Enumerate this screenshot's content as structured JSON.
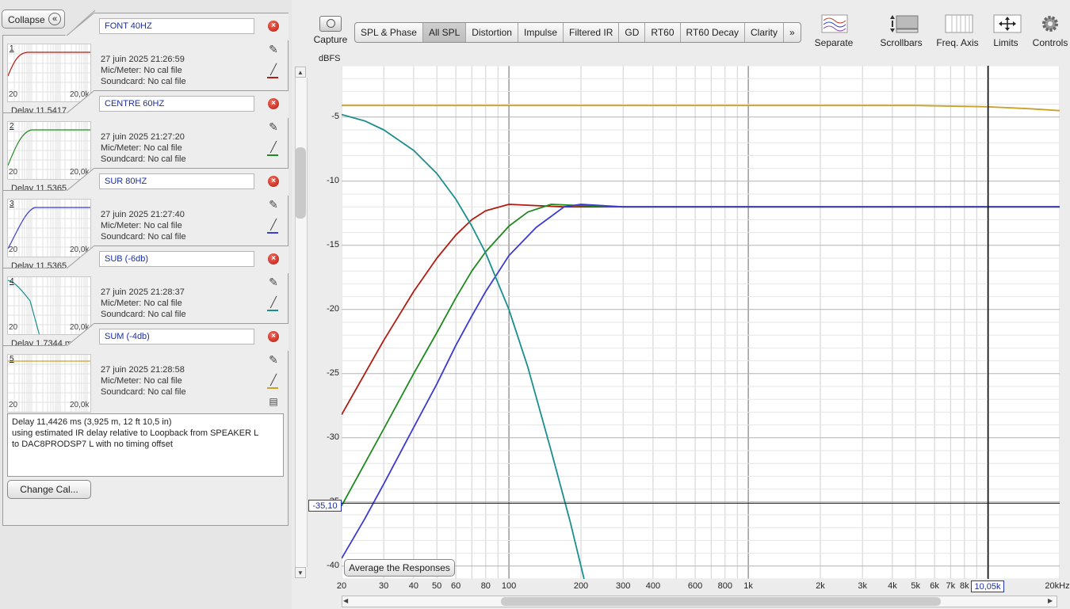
{
  "left_panel": {
    "collapse_label": "Collapse",
    "collapse_icon": "«",
    "measurements": [
      {
        "number": "1",
        "name": "FONT 40HZ",
        "date": "27 juin 2025 21:26:59",
        "mic": "Mic/Meter: No cal file",
        "soundcard": "Soundcard: No cal file",
        "axis_start": "20",
        "axis_end": "20,0k",
        "delay": "Delay 11,5417",
        "color": "#b01c10"
      },
      {
        "number": "2",
        "name": "CENTRE 60HZ",
        "date": "27 juin 2025 21:27:20",
        "mic": "Mic/Meter: No cal file",
        "soundcard": "Soundcard: No cal file",
        "axis_start": "20",
        "axis_end": "20,0k",
        "delay": "Delay 11,5365",
        "color": "#1f8a1f"
      },
      {
        "number": "3",
        "name": "SUR 80HZ",
        "date": "27 juin 2025 21:27:40",
        "mic": "Mic/Meter: No cal file",
        "soundcard": "Soundcard: No cal file",
        "axis_start": "20",
        "axis_end": "20,0k",
        "delay": "Delay 11,5365",
        "color": "#3b3bd1"
      },
      {
        "number": "4",
        "name": "SUB (-6db)",
        "date": "27 juin 2025 21:28:37",
        "mic": "Mic/Meter: No cal file",
        "soundcard": "Soundcard: No cal file",
        "axis_start": "20",
        "axis_end": "20,0k",
        "delay": "Delay 1,7344 m",
        "color": "#1a8f8f"
      },
      {
        "number": "5",
        "name": "SUM (-4db)",
        "date": "27 juin 2025 21:28:58",
        "mic": "Mic/Meter: No cal file",
        "soundcard": "Soundcard: No cal file",
        "axis_start": "20",
        "axis_end": "20,0k",
        "delay": "",
        "color": "#c9a227"
      }
    ],
    "delay_info": {
      "line1": "Delay 11,4426 ms (3,925 m, 12 ft 10,5 in)",
      "line2": "using estimated IR delay relative to Loopback from SPEAKER L",
      "line3": "to DAC8PRODSP7 L with no timing offset"
    },
    "change_cal_label": "Change Cal..."
  },
  "toolbar": {
    "capture_label": "Capture",
    "tabs": [
      "SPL & Phase",
      "All SPL",
      "Distortion",
      "Impulse",
      "Filtered IR",
      "GD",
      "RT60",
      "RT60 Decay",
      "Clarity"
    ],
    "active_tab": "All SPL",
    "more_tabs": "»",
    "tools": [
      {
        "label": "Separate",
        "icon": "separate-icon"
      },
      {
        "label": "Scrollbars",
        "icon": "scrollbars-icon"
      },
      {
        "label": "Freq. Axis",
        "icon": "freq-axis-icon"
      },
      {
        "label": "Limits",
        "icon": "limits-icon"
      },
      {
        "label": "Controls",
        "icon": "controls-icon"
      }
    ]
  },
  "graph": {
    "y_unit": "dBFS",
    "y_cursor": "-35,10",
    "x_cursor": "10,05k",
    "average_button": "Average the Responses"
  },
  "chart_data": {
    "type": "line",
    "xlabel": "",
    "ylabel": "dBFS",
    "x_scale": "log",
    "xlim": [
      20,
      20000
    ],
    "ylim": [
      -41,
      -1
    ],
    "y_ticks": [
      -5,
      -10,
      -15,
      -20,
      -25,
      -30,
      -35,
      -40
    ],
    "y_tick_labels": [
      "-5",
      "-10",
      "-15",
      "-20",
      "-25",
      "-30",
      "-35",
      "-40"
    ],
    "x_ticks": [
      20,
      30,
      40,
      50,
      60,
      80,
      100,
      200,
      300,
      400,
      600,
      800,
      1000,
      2000,
      3000,
      4000,
      5000,
      6000,
      7000,
      8000,
      20000
    ],
    "x_tick_labels": [
      "20",
      "30",
      "40",
      "50",
      "60",
      "80",
      "100",
      "200",
      "300",
      "400",
      "600",
      "800",
      "1k",
      "2k",
      "3k",
      "4k",
      "5k",
      "6k",
      "7k",
      "8k",
      "20kHz"
    ],
    "grid": true,
    "series": [
      {
        "color": "#b01c10",
        "x": [
          20,
          25,
          30,
          40,
          50,
          60,
          70,
          80,
          100,
          130,
          170,
          250,
          400,
          20000
        ],
        "y": [
          -28.2,
          -25.0,
          -22.4,
          -18.6,
          -16.0,
          -14.2,
          -13.0,
          -12.3,
          -11.8,
          -11.9,
          -12.0,
          -12.0,
          -12.0,
          -12.0
        ]
      },
      {
        "color": "#1f8a1f",
        "x": [
          20,
          25,
          30,
          40,
          50,
          60,
          70,
          80,
          100,
          120,
          150,
          200,
          300,
          20000
        ],
        "y": [
          -35.3,
          -32.0,
          -29.3,
          -25.0,
          -21.8,
          -19.1,
          -17.0,
          -15.5,
          -13.5,
          -12.4,
          -11.8,
          -11.9,
          -12.0,
          -12.0
        ]
      },
      {
        "color": "#3b3bd1",
        "x": [
          20,
          25,
          30,
          40,
          50,
          60,
          70,
          80,
          100,
          130,
          170,
          200,
          300,
          20000
        ],
        "y": [
          -39.4,
          -36.3,
          -33.6,
          -29.2,
          -25.8,
          -22.8,
          -20.5,
          -18.6,
          -15.8,
          -13.6,
          -12.0,
          -11.8,
          -12.0,
          -12.0
        ]
      },
      {
        "color": "#1a8f8f",
        "x": [
          20,
          25,
          30,
          40,
          50,
          60,
          70,
          80,
          100,
          120,
          150,
          180,
          206
        ],
        "y": [
          -4.8,
          -5.3,
          -6.0,
          -7.6,
          -9.4,
          -11.4,
          -13.5,
          -15.6,
          -20.0,
          -24.5,
          -31.0,
          -36.5,
          -41.0
        ]
      },
      {
        "color": "#c9a227",
        "x": [
          20,
          100,
          1000,
          5000,
          10000,
          15000,
          20000
        ],
        "y": [
          -4.1,
          -4.1,
          -4.1,
          -4.1,
          -4.2,
          -4.35,
          -4.5
        ]
      }
    ]
  }
}
